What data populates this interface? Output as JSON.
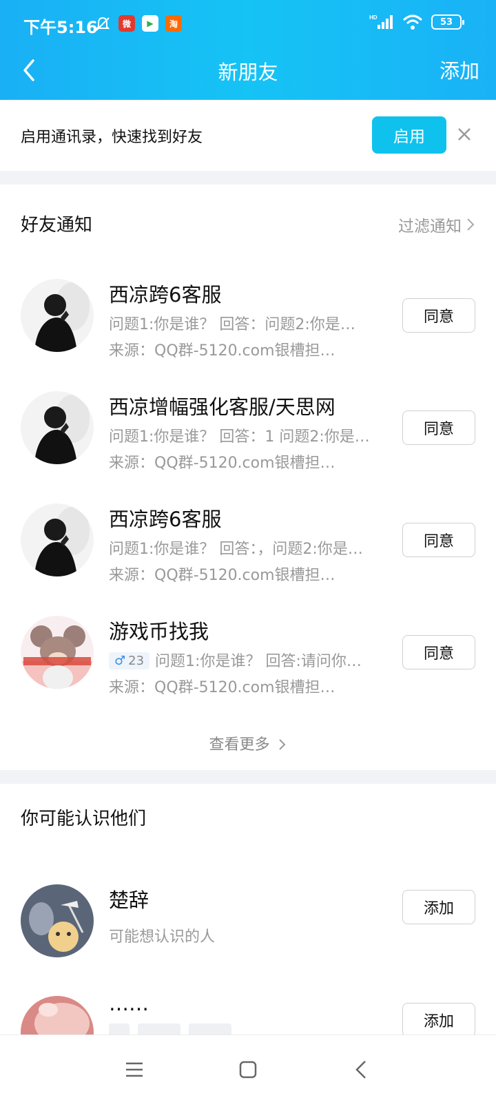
{
  "status_bar": {
    "time": "下午5:16",
    "apps": [
      {
        "name": "weibo-app-icon",
        "text": "微",
        "color": "#e03a2f"
      },
      {
        "name": "play-store-icon",
        "text": "▶",
        "color": "#ffffff"
      },
      {
        "name": "taobao-app-icon",
        "text": "淘",
        "color": "#ff6a00"
      }
    ],
    "battery": "53",
    "network": "HD"
  },
  "nav": {
    "title": "新朋友",
    "action": "添加"
  },
  "banner": {
    "text": "启用通讯录，快速找到好友",
    "button": "启用"
  },
  "friend_notices": {
    "title": "好友通知",
    "filter_label": "过滤通知",
    "items": [
      {
        "name": "西凉跨6客服",
        "question": "问题1:你是谁？ 回答：问题2:你是…",
        "source": "来源：QQ群-5120.com银槽担…",
        "button": "同意"
      },
      {
        "name": "西凉增幅强化客服/天思网",
        "question": "问题1:你是谁？ 回答：1 问题2:你是…",
        "source": "来源：QQ群-5120.com银槽担…",
        "button": "同意"
      },
      {
        "name": "西凉跨6客服",
        "question": "问题1:你是谁？ 回答：，问题2:你是…",
        "source": "来源：QQ群-5120.com银槽担…",
        "button": "同意"
      },
      {
        "name": "游戏币找我",
        "gender": "♂",
        "age": "23",
        "question": "问题1:你是谁？ 回答:请问你…",
        "source": "来源：QQ群-5120.com银槽担…",
        "button": "同意"
      }
    ],
    "more_label": "查看更多"
  },
  "suggestions": {
    "title": "你可能认识他们",
    "items": [
      {
        "name": "楚辞",
        "subtitle": "可能想认识的人",
        "button": "添加"
      },
      {
        "name": "……",
        "button": "添加"
      }
    ]
  },
  "colors": {
    "header": "#19b0f5",
    "enable_button": "#0fc2ee",
    "gray_text": "#999999"
  }
}
